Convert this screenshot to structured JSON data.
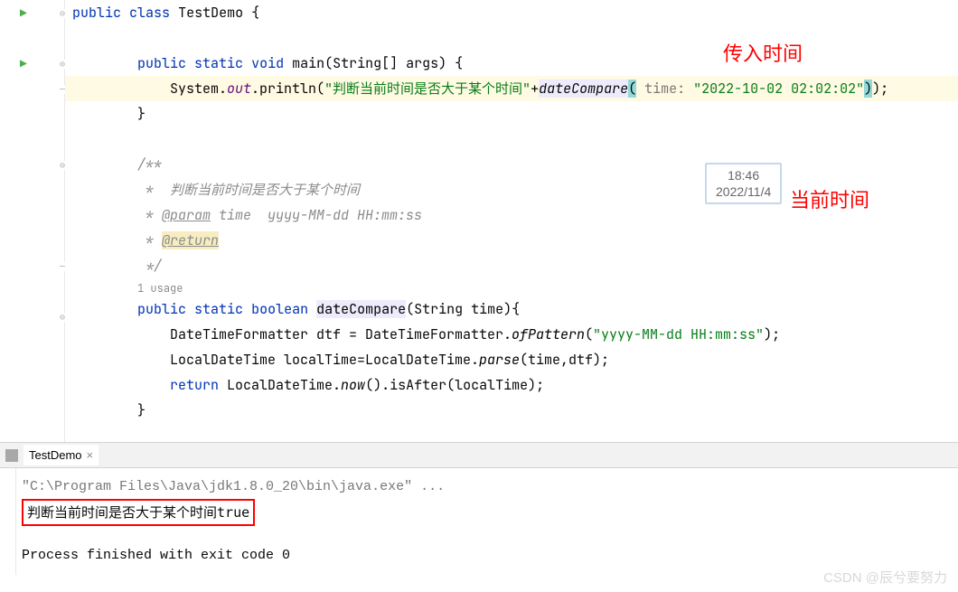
{
  "code": {
    "class_decl": {
      "kw_public": "public",
      "kw_class": "class",
      "name": "TestDemo",
      "brace": " {"
    },
    "main_sig": {
      "kw_public": "public",
      "kw_static": "static",
      "kw_void": "void",
      "name": "main",
      "params": "(String[] args) {"
    },
    "println_line": {
      "prefix": "            System.",
      "out": "out",
      "dot_println": ".println(",
      "str": "\"判断当前时间是否大于某个时间\"",
      "plus": "+",
      "call": "dateCompare",
      "paren_open": "(",
      "hint": " time: ",
      "arg_str": "\"2022-10-02 02:02:02\"",
      "paren_close": ")",
      "tail": ");"
    },
    "main_close": "        }",
    "doc_open": "/**",
    "doc_line1": " *  判断当前时间是否大于某个时间",
    "doc_param_tag": "@param",
    "doc_param_rest": " time  yyyy-MM-dd HH:mm:ss",
    "doc_return": "@return",
    "doc_close": " */",
    "usage_hint": "1 usage",
    "method_sig": {
      "kw_public": "public",
      "kw_static": "static",
      "kw_boolean": "boolean",
      "name": "dateCompare",
      "params": "(String time){"
    },
    "body1": {
      "prefix": "            DateTimeFormatter dtf = DateTimeFormatter.",
      "m": "ofPattern",
      "open": "(",
      "str": "\"yyyy-MM-dd HH:mm:ss\"",
      "close": ");"
    },
    "body2": {
      "prefix": "            LocalDateTime localTime=LocalDateTime.",
      "m": "parse",
      "args": "(time,dtf);"
    },
    "body3": {
      "prefix": "            ",
      "kw": "return",
      "mid": " LocalDateTime.",
      "m": "now",
      "rest": "().isAfter(localTime);"
    },
    "method_close": "        }"
  },
  "annotations": {
    "label1": "传入时间",
    "label2": "当前时间",
    "clock_time": "18:46",
    "clock_date": "2022/11/4"
  },
  "console": {
    "tab_name": "TestDemo",
    "cmd": "\"C:\\Program Files\\Java\\jdk1.8.0_20\\bin\\java.exe\" ...",
    "output": "判断当前时间是否大于某个时间true",
    "exit_msg": "Process finished with exit code 0"
  },
  "watermark": "CSDN @辰兮要努力"
}
